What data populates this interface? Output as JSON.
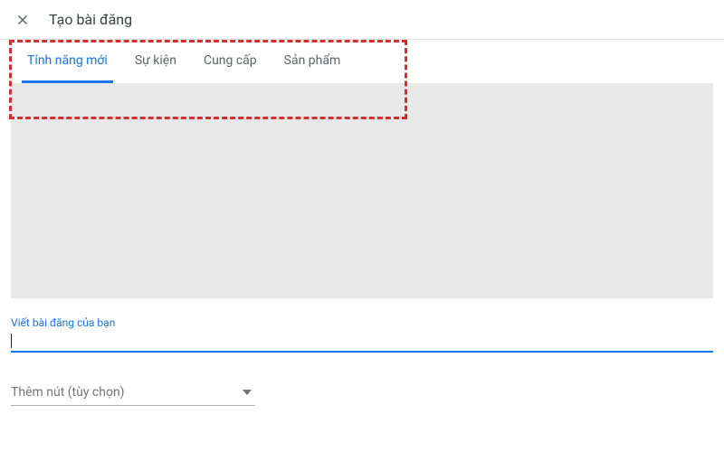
{
  "header": {
    "title": "Tạo bài đăng"
  },
  "tabs": [
    {
      "label": "Tính năng mới",
      "active": true
    },
    {
      "label": "Sự kiện",
      "active": false
    },
    {
      "label": "Cung cấp",
      "active": false
    },
    {
      "label": "Sản phẩm",
      "active": false
    }
  ],
  "fields": {
    "write_post_label": "Viết bài đăng của bạn",
    "write_post_value": "",
    "add_button_label": "Thêm nút (tùy chọn)"
  }
}
